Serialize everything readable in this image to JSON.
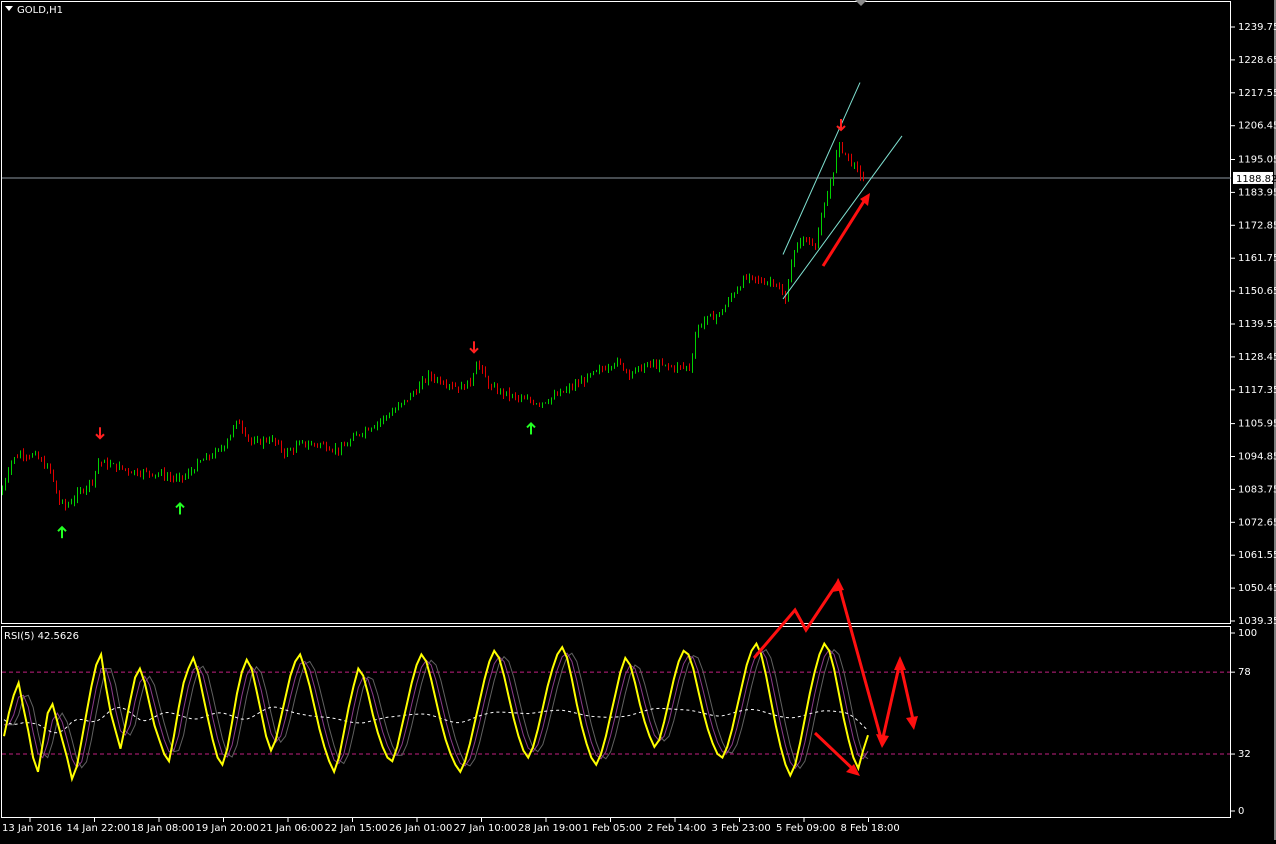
{
  "chart_data": [
    {
      "type": "candlestick",
      "symbol_label": "GOLD,H1",
      "current_price_label": "1188.82",
      "current_price": 1188.82,
      "ylim": [
        1039.35,
        1244.0
      ],
      "y_ticks": [
        "1239.75",
        "1228.65",
        "1217.55",
        "1206.45",
        "1195.05",
        "1183.95",
        "1172.85",
        "1161.75",
        "1150.65",
        "1139.55",
        "1128.45",
        "1117.35",
        "1105.95",
        "1094.85",
        "1083.75",
        "1072.65",
        "1061.55",
        "1050.45",
        "1039.35"
      ],
      "x_tick_labels": [
        "13 Jan 2016",
        "14 Jan 22:00",
        "18 Jan 08:00",
        "19 Jan 20:00",
        "21 Jan 06:00",
        "22 Jan 15:00",
        "26 Jan 01:00",
        "27 Jan 10:00",
        "28 Jan 19:00",
        "1 Feb 05:00",
        "2 Feb 14:00",
        "3 Feb 23:00",
        "5 Feb 09:00",
        "8 Feb 18:00"
      ],
      "price_path": [
        [
          0,
          1082
        ],
        [
          10,
          1093
        ],
        [
          20,
          1096
        ],
        [
          35,
          1095
        ],
        [
          50,
          1090
        ],
        [
          58,
          1080
        ],
        [
          65,
          1078
        ],
        [
          80,
          1083
        ],
        [
          92,
          1087
        ],
        [
          98,
          1093
        ],
        [
          110,
          1092
        ],
        [
          130,
          1090
        ],
        [
          160,
          1089
        ],
        [
          176,
          1087
        ],
        [
          185,
          1088
        ],
        [
          200,
          1093
        ],
        [
          220,
          1097
        ],
        [
          238,
          1107
        ],
        [
          252,
          1099
        ],
        [
          270,
          1101
        ],
        [
          285,
          1096
        ],
        [
          300,
          1099
        ],
        [
          320,
          1099
        ],
        [
          340,
          1097
        ],
        [
          360,
          1103
        ],
        [
          380,
          1107
        ],
        [
          400,
          1112
        ],
        [
          415,
          1117
        ],
        [
          428,
          1122
        ],
        [
          445,
          1120
        ],
        [
          460,
          1118
        ],
        [
          470,
          1120
        ],
        [
          476,
          1127
        ],
        [
          490,
          1118
        ],
        [
          505,
          1116
        ],
        [
          520,
          1114
        ],
        [
          540,
          1113
        ],
        [
          560,
          1116
        ],
        [
          580,
          1120
        ],
        [
          600,
          1124
        ],
        [
          615,
          1127
        ],
        [
          630,
          1123
        ],
        [
          650,
          1126
        ],
        [
          670,
          1125
        ],
        [
          690,
          1125
        ],
        [
          696,
          1138
        ],
        [
          705,
          1141
        ],
        [
          720,
          1143
        ],
        [
          735,
          1151
        ],
        [
          745,
          1155
        ],
        [
          760,
          1154
        ],
        [
          775,
          1154
        ],
        [
          785,
          1147
        ],
        [
          790,
          1160
        ],
        [
          800,
          1168
        ],
        [
          815,
          1167
        ],
        [
          825,
          1180
        ],
        [
          832,
          1190
        ],
        [
          838,
          1200
        ],
        [
          845,
          1197
        ],
        [
          855,
          1192
        ],
        [
          865,
          1188
        ]
      ],
      "arrows_up": [
        {
          "x": 62,
          "price": 1071
        },
        {
          "x": 180,
          "price": 1079
        },
        {
          "x": 531,
          "price": 1106
        }
      ],
      "arrows_down": [
        {
          "x": 100,
          "price": 1101
        },
        {
          "x": 474,
          "price": 1130
        },
        {
          "x": 841,
          "price": 1205
        }
      ],
      "channel": {
        "upper": [
          [
            783,
            1163
          ],
          [
            860,
            1221
          ]
        ],
        "lower": [
          [
            783,
            1148
          ],
          [
            902,
            1203
          ]
        ]
      }
    },
    {
      "type": "line",
      "title": "RSI(5) 42.5626",
      "ylim": [
        0,
        100
      ],
      "y_ticks": [
        "100",
        "78",
        "32",
        "0"
      ],
      "levels": [
        78,
        32
      ],
      "rsi_values": [
        42,
        55,
        65,
        72,
        58,
        45,
        30,
        22,
        38,
        55,
        60,
        50,
        40,
        30,
        18,
        25,
        40,
        55,
        70,
        82,
        88,
        70,
        55,
        45,
        35,
        48,
        62,
        75,
        80,
        72,
        60,
        48,
        40,
        32,
        28,
        42,
        58,
        72,
        80,
        86,
        78,
        65,
        52,
        40,
        30,
        26,
        35,
        50,
        66,
        78,
        85,
        80,
        68,
        55,
        42,
        34,
        40,
        52,
        64,
        76,
        84,
        88,
        80,
        70,
        58,
        46,
        36,
        28,
        22,
        30,
        44,
        58,
        70,
        80,
        76,
        66,
        54,
        44,
        36,
        30,
        28,
        36,
        48,
        60,
        72,
        82,
        88,
        84,
        74,
        62,
        50,
        40,
        32,
        26,
        22,
        28,
        38,
        50,
        62,
        74,
        84,
        90,
        86,
        76,
        64,
        52,
        42,
        34,
        30,
        36,
        46,
        58,
        70,
        80,
        88,
        92,
        86,
        74,
        60,
        48,
        38,
        30,
        26,
        32,
        42,
        54,
        66,
        78,
        86,
        82,
        72,
        60,
        50,
        42,
        36,
        40,
        50,
        62,
        74,
        84,
        90,
        88,
        80,
        68,
        56,
        46,
        38,
        32,
        30,
        36,
        46,
        58,
        70,
        82,
        90,
        94,
        88,
        76,
        62,
        48,
        36,
        26,
        20,
        26,
        38,
        52,
        66,
        78,
        88,
        94,
        90,
        80,
        66,
        52,
        40,
        30,
        24,
        34,
        42.5626
      ]
    }
  ]
}
